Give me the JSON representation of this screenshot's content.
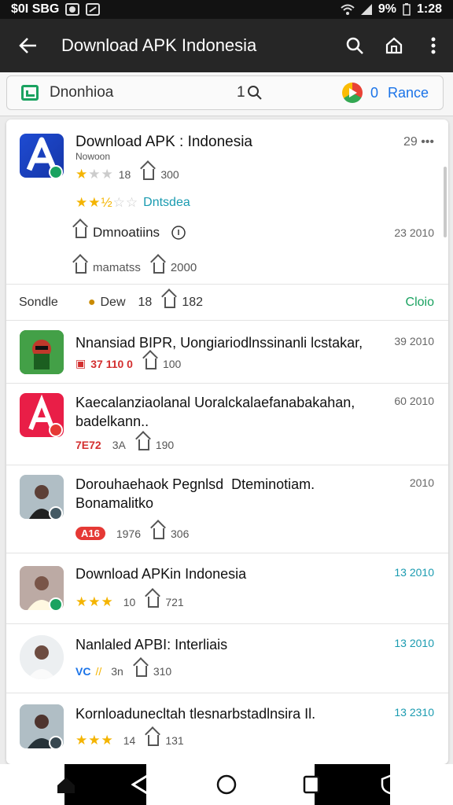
{
  "status": {
    "left": "$0I SBG",
    "battery": "9%",
    "time": "1:28"
  },
  "appbar": {
    "title": "Download APK Indonesia"
  },
  "strip": {
    "query": "Dnonhioa",
    "count": "1",
    "zero": "0",
    "link": "Rance"
  },
  "featured": {
    "title": "Download APK : Indonesia",
    "subtitle": "Nowoon",
    "time": "29 •••",
    "line1_count": "18",
    "line1_downloads": "300",
    "line2_tag": "Dntsdea",
    "line3_label": "Dmnoatiins",
    "line3_date": "23 2010",
    "line4_label": "mamatss",
    "line4_count": "2000"
  },
  "section": {
    "label": "Sondle",
    "dev": "Dew",
    "count": "18",
    "downloads": "182",
    "link": "Cloio"
  },
  "apps": [
    {
      "title": "Nnansiad BIPR, Uongiariodlnssinanli lcstakar,",
      "time": "39 2010",
      "meta_a": "37 110 0",
      "downloads": "100",
      "icon": "green-robot-icon"
    },
    {
      "title": "Kaecalanziaolanal Uoralckalaefanabakahan, badelkann..",
      "time": "60 2010",
      "meta_a": "7E72",
      "meta_b": "3A",
      "downloads": "190",
      "icon": "red-letter-a-icon"
    },
    {
      "title": "Dorouhaehaok Pegnlsd  Dteminotiam. Bonamalitko",
      "time": "2010",
      "meta_a": "A16",
      "meta_b": "1976",
      "downloads": "306",
      "icon": "person-photo-icon"
    },
    {
      "title": "Download APKin Indonesia",
      "time": "13 2010",
      "rating": 3,
      "meta_b": "10",
      "downloads": "721",
      "icon": "person-photo-icon"
    },
    {
      "title": "Nanlaled APBI: Interliais",
      "time": "13 2010",
      "meta_a": "VC",
      "meta_b": "3n",
      "downloads": "310",
      "icon": "person-photo-icon"
    },
    {
      "title": "Kornloadunecltah tlesnarbstadlnsira Il.",
      "time": "13 2310",
      "rating": 3,
      "meta_b": "14",
      "downloads": "131",
      "icon": "person-photo-icon"
    }
  ],
  "colors": {
    "appbar": "#262626",
    "accent": "#1a73e8",
    "star": "#f4b400",
    "teal": "#1a9bb0"
  }
}
